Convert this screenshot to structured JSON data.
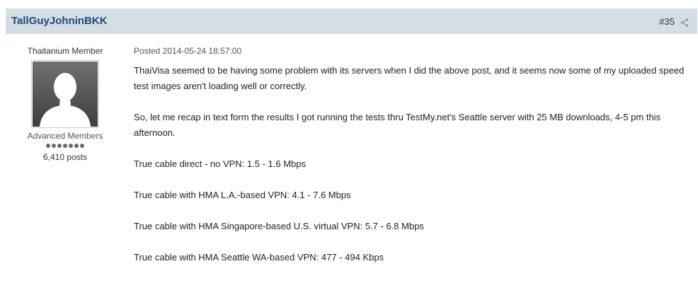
{
  "post": {
    "author": "TallGuyJohninBKK",
    "number": "#35",
    "member_title": "Thaitanium Member",
    "group": "Advanced Members",
    "rank_pips": 7,
    "posts": "6,410 posts",
    "date": "Posted 2014-05-24 18:57:00",
    "paragraphs": [
      "ThaiVisa seemed to be having some problem with its servers when I did the above post, and it seems now some of my uploaded speed test images aren't loading well or correctly.",
      "So, let me recap in text form the results I got running the tests thru TestMy.net's Seattle server with 25 MB downloads, 4-5 pm this afternoon.",
      "True cable direct - no VPN: 1.5 - 1.6 Mbps",
      "True cable with HMA L.A.-based VPN: 4.1 - 7.6 Mbps",
      "True cable with HMA Singapore-based U.S. virtual VPN: 5.7 - 6.8 Mbps",
      "True cable with HMA Seattle WA-based VPN: 477 - 494 Kbps"
    ]
  },
  "icons": {
    "share": "share-icon",
    "avatar": "default-avatar-icon"
  },
  "colors": {
    "header_bg": "#d5dde5",
    "author_link": "#1d4a7d"
  }
}
